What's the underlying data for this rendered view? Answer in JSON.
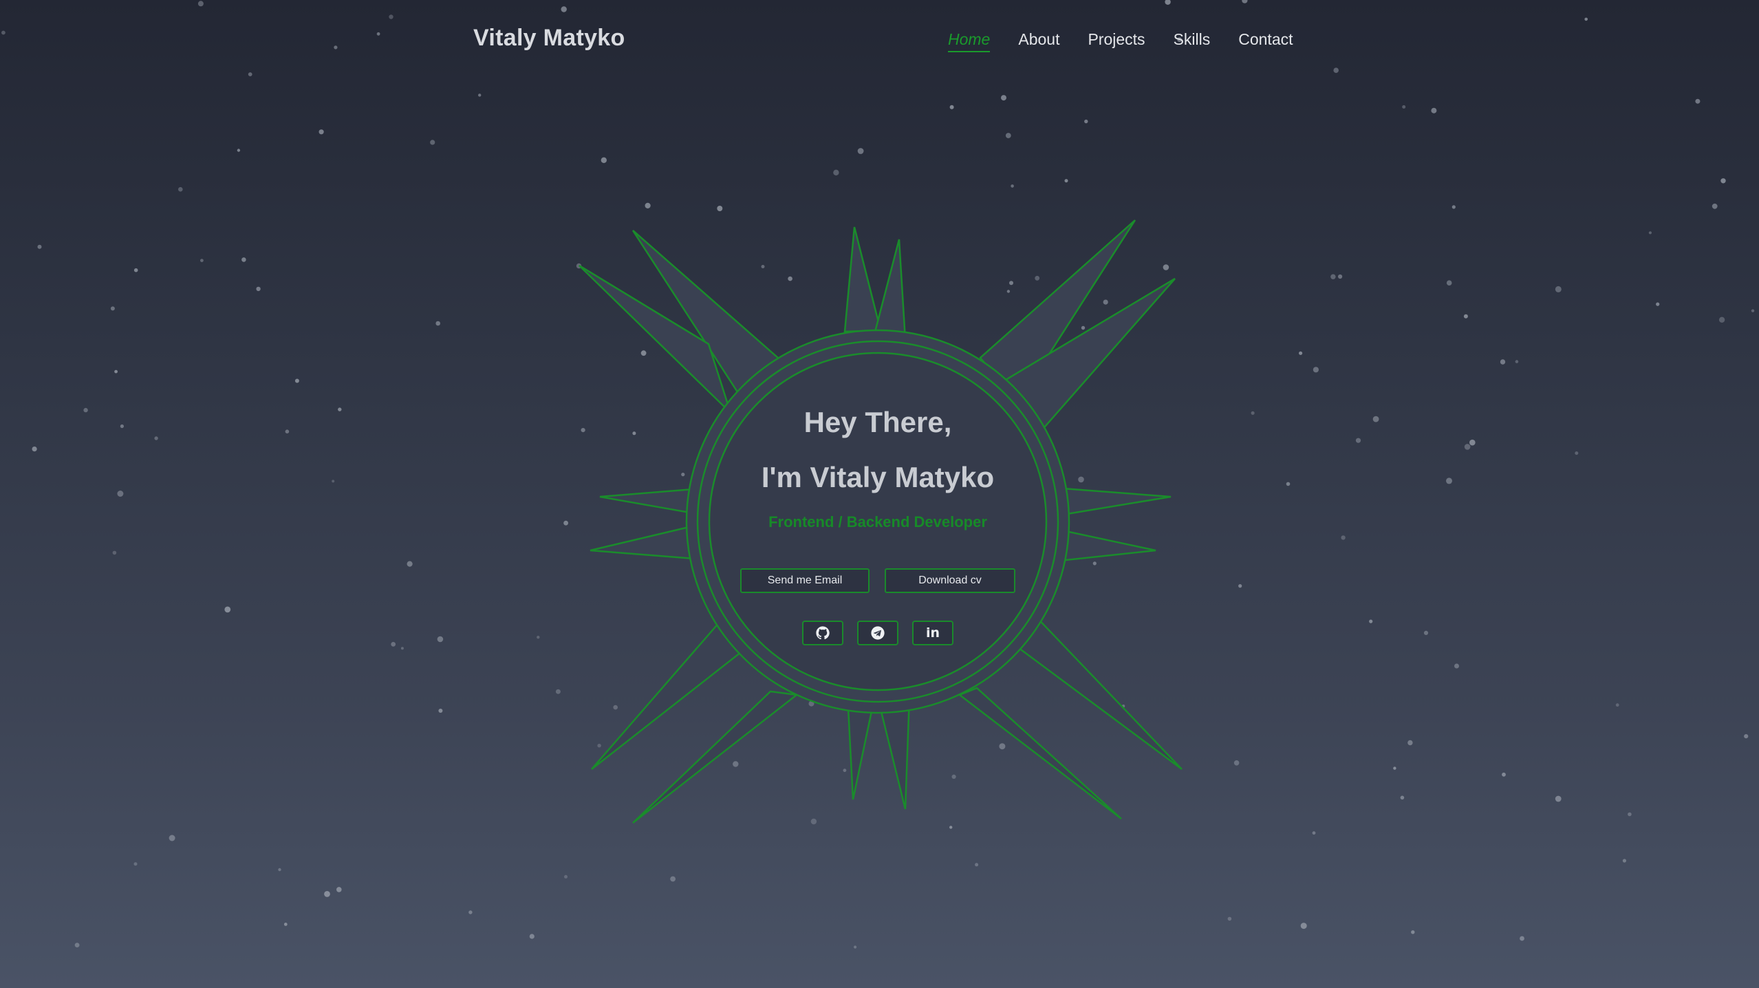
{
  "header": {
    "brand": "Vitaly Matyko",
    "nav": [
      {
        "label": "Home",
        "active": true
      },
      {
        "label": "About",
        "active": false
      },
      {
        "label": "Projects",
        "active": false
      },
      {
        "label": "Skills",
        "active": false
      },
      {
        "label": "Contact",
        "active": false
      }
    ]
  },
  "hero": {
    "greeting": "Hey There,",
    "intro": "I'm Vitaly Matyko",
    "role": "Frontend / Backend Developer",
    "buttons": {
      "email": "Send me Email",
      "cv": "Download cv"
    },
    "social": [
      {
        "icon": "github-icon"
      },
      {
        "icon": "telegram-icon"
      },
      {
        "icon": "linkedin-icon",
        "glyph": "in"
      }
    ]
  },
  "colors": {
    "accent": "#1a9a2c",
    "text": "#d9dbe0",
    "background_top": "#232734",
    "background_bottom": "#4a5366"
  }
}
